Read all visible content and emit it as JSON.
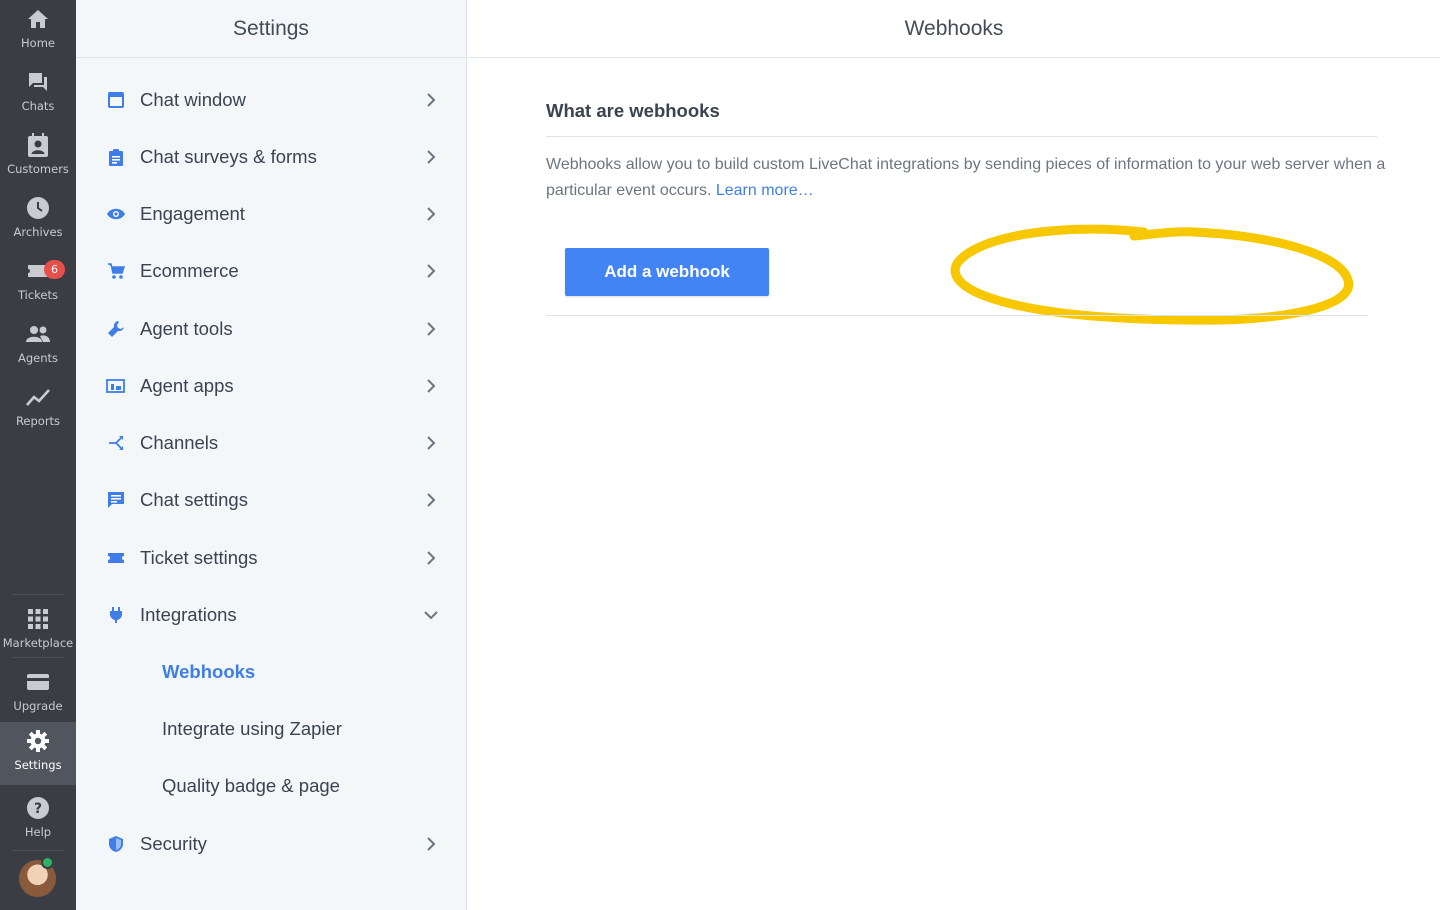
{
  "colors": {
    "accent": "#3f7ee8",
    "button": "#4384f5",
    "rail": "#3a3d43",
    "highlight": "#f7c800",
    "badge": "#e5504b"
  },
  "rail": {
    "items": [
      {
        "label": "Home",
        "icon": "home-icon"
      },
      {
        "label": "Chats",
        "icon": "chats-icon"
      },
      {
        "label": "Customers",
        "icon": "customers-icon"
      },
      {
        "label": "Archives",
        "icon": "clock-icon"
      },
      {
        "label": "Tickets",
        "icon": "ticket-icon"
      },
      {
        "label": "Agents",
        "icon": "agents-icon"
      },
      {
        "label": "Reports",
        "icon": "reports-icon"
      }
    ],
    "tickets_badge": "6",
    "bottom": [
      {
        "label": "Marketplace",
        "icon": "grid-icon"
      },
      {
        "label": "Upgrade",
        "icon": "card-icon"
      },
      {
        "label": "Settings",
        "icon": "gear-icon"
      },
      {
        "label": "Help",
        "icon": "help-icon"
      }
    ]
  },
  "sidebar": {
    "title": "Settings",
    "items": [
      {
        "label": "Chat window",
        "icon": "window-icon"
      },
      {
        "label": "Chat surveys & forms",
        "icon": "clipboard-icon"
      },
      {
        "label": "Engagement",
        "icon": "eye-icon"
      },
      {
        "label": "Ecommerce",
        "icon": "cart-icon"
      },
      {
        "label": "Agent tools",
        "icon": "wrench-icon"
      },
      {
        "label": "Agent apps",
        "icon": "apps-icon"
      },
      {
        "label": "Channels",
        "icon": "channels-icon"
      },
      {
        "label": "Chat settings",
        "icon": "chat-settings-icon"
      },
      {
        "label": "Ticket settings",
        "icon": "ticket-settings-icon"
      },
      {
        "label": "Integrations",
        "icon": "plug-icon"
      }
    ],
    "sub_items": [
      {
        "label": "Webhooks"
      },
      {
        "label": "Integrate using Zapier"
      },
      {
        "label": "Quality badge & page"
      }
    ],
    "last_item": {
      "label": "Security",
      "icon": "shield-icon"
    }
  },
  "main": {
    "title": "Webhooks",
    "section_title": "What are webhooks",
    "description": "Webhooks allow you to build custom LiveChat integrations by sending pieces of information to your web server when a particular event occurs.",
    "learn_more": "Learn more…",
    "button_label": "Add a webhook"
  }
}
